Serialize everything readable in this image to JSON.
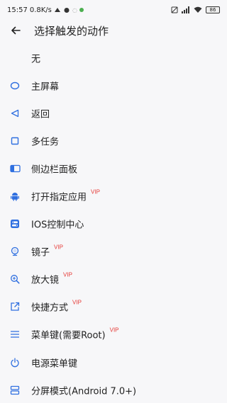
{
  "status_bar": {
    "time": "15:57",
    "speed": "0.8K/s",
    "battery": "86"
  },
  "header": {
    "title": "选择触发的动作"
  },
  "vip_label": "VIP",
  "items": [
    {
      "label": "无",
      "icon": "none",
      "vip": false
    },
    {
      "label": "主屏幕",
      "icon": "home-icon",
      "vip": false
    },
    {
      "label": "返回",
      "icon": "back-triangle-icon",
      "vip": false
    },
    {
      "label": "多任务",
      "icon": "recent-apps-icon",
      "vip": false
    },
    {
      "label": "侧边栏面板",
      "icon": "side-panel-icon",
      "vip": false
    },
    {
      "label": "打开指定应用",
      "icon": "android-icon",
      "vip": true
    },
    {
      "label": "IOS控制中心",
      "icon": "control-center-icon",
      "vip": false
    },
    {
      "label": "镜子",
      "icon": "mirror-icon",
      "vip": true
    },
    {
      "label": "放大镜",
      "icon": "magnifier-icon",
      "vip": true
    },
    {
      "label": "快捷方式",
      "icon": "shortcut-icon",
      "vip": true
    },
    {
      "label": "菜单键(需要Root)",
      "icon": "menu-icon",
      "vip": true
    },
    {
      "label": "电源菜单键",
      "icon": "power-icon",
      "vip": false
    },
    {
      "label": "分屏模式(Android 7.0+)",
      "icon": "split-screen-icon",
      "vip": false
    }
  ],
  "colors": {
    "accent": "#2f6fe0",
    "vip": "#e53935",
    "background": "#f7f7f9"
  }
}
